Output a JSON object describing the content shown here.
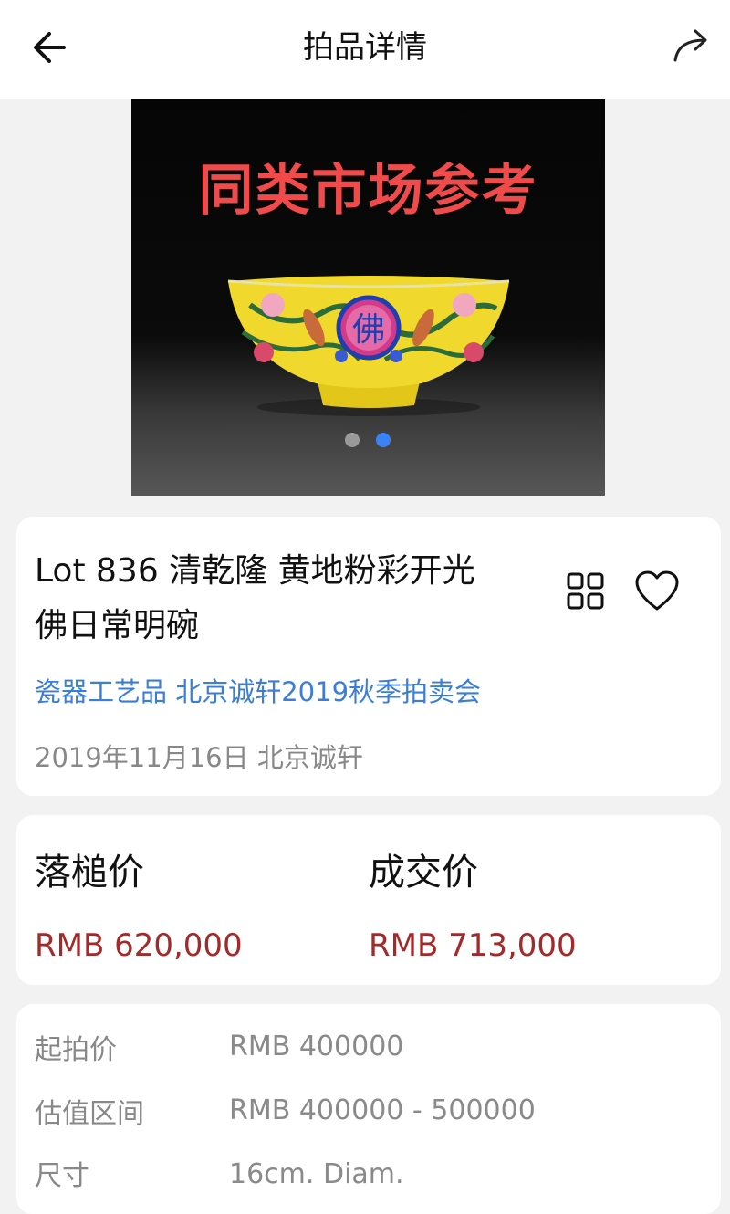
{
  "header": {
    "title": "拍品详情",
    "back_icon": "arrow-left-icon",
    "share_icon": "share-arrow-icon"
  },
  "gallery": {
    "banner_text": "同类市场参考",
    "bowl_character": "佛",
    "slide_count": 2,
    "active_slide": 2,
    "colors": {
      "active_dot": "#3b82f6",
      "inactive_dot": "#9a9a9a",
      "banner": "#f04a4a"
    }
  },
  "lot": {
    "title_line1": "Lot 836 清乾隆 黄地粉彩开光",
    "title_line2": "佛日常明碗",
    "category": "瓷器工艺品 北京诚轩2019秋季拍卖会",
    "meta": "2019年11月16日 北京诚轩",
    "icons": {
      "grid": "grid-icon",
      "favorite": "heart-icon"
    }
  },
  "prices": {
    "hammer_label": "落槌价",
    "hammer_value": "RMB 620,000",
    "deal_label": "成交价",
    "deal_value": "RMB 713,000",
    "value_color": "#a32a2a"
  },
  "details": {
    "rows": [
      {
        "label": "起拍价",
        "value": "RMB 400000"
      },
      {
        "label": "估值区间",
        "value": "RMB 400000 - 500000"
      },
      {
        "label": "尺寸",
        "value": "16cm. Diam."
      }
    ]
  }
}
